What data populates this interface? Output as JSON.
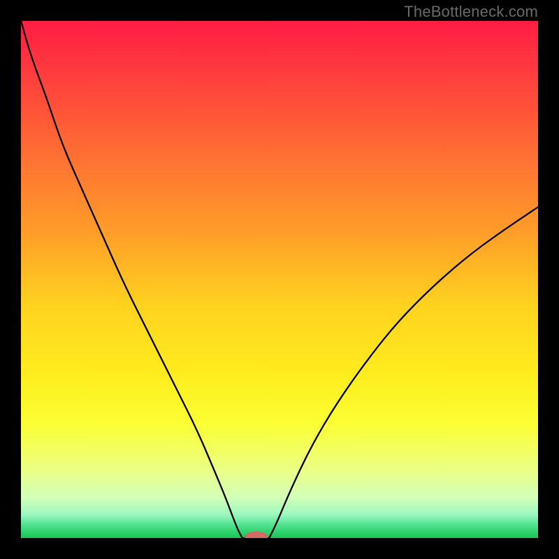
{
  "watermark": "TheBottleneck.com",
  "chart_data": {
    "type": "line",
    "title": "",
    "xlabel": "",
    "ylabel": "",
    "xlim": [
      0,
      100
    ],
    "ylim": [
      0,
      100
    ],
    "gradient_stops": [
      {
        "offset": 0.0,
        "color": "#ff1d44"
      },
      {
        "offset": 0.1,
        "color": "#ff3c3e"
      },
      {
        "offset": 0.25,
        "color": "#ff6c33"
      },
      {
        "offset": 0.4,
        "color": "#ff9a29"
      },
      {
        "offset": 0.55,
        "color": "#ffd21f"
      },
      {
        "offset": 0.68,
        "color": "#feec1d"
      },
      {
        "offset": 0.78,
        "color": "#fbff33"
      },
      {
        "offset": 0.87,
        "color": "#eaff86"
      },
      {
        "offset": 0.92,
        "color": "#d4ffb6"
      },
      {
        "offset": 0.955,
        "color": "#9cf7bf"
      },
      {
        "offset": 0.975,
        "color": "#4fe28e"
      },
      {
        "offset": 1.0,
        "color": "#18c455"
      }
    ],
    "series": [
      {
        "name": "left-branch",
        "x": [
          0.0,
          2.0,
          5.0,
          8.0,
          12.0,
          16.0,
          20.0,
          25.0,
          30.0,
          34.0,
          37.0,
          39.5,
          41.0,
          42.0,
          42.8
        ],
        "y": [
          100.0,
          93.0,
          85.0,
          76.0,
          67.0,
          58.0,
          49.0,
          39.0,
          29.0,
          21.0,
          14.0,
          8.0,
          4.0,
          1.5,
          0.0
        ]
      },
      {
        "name": "valley-floor",
        "x": [
          42.8,
          44.5,
          46.5,
          48.0
        ],
        "y": [
          0.0,
          0.0,
          0.0,
          0.0
        ]
      },
      {
        "name": "right-branch",
        "x": [
          48.0,
          49.5,
          52.0,
          56.0,
          61.0,
          67.0,
          73.0,
          80.0,
          87.0,
          94.0,
          100.0
        ],
        "y": [
          0.0,
          3.0,
          9.0,
          17.5,
          26.0,
          34.5,
          42.0,
          49.0,
          55.0,
          60.0,
          64.0
        ]
      }
    ],
    "marker": {
      "x": 45.5,
      "y": 0.2,
      "rx": 2.2,
      "ry": 1.1,
      "color": "#d46a63"
    }
  }
}
